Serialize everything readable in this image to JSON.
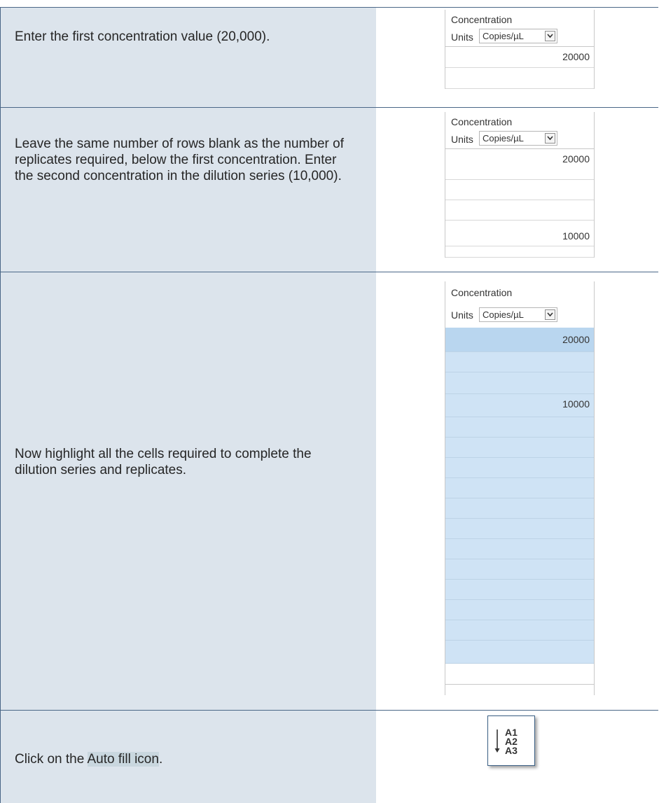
{
  "rows": [
    {
      "instruction": "Enter the first concentration value (20,000)."
    },
    {
      "instruction": "Leave the same number of rows blank as the number of replicates required, below the first concentration. Enter the second concentration in the dilution series (10,000)."
    },
    {
      "instruction": "Now highlight all the cells required to complete the dilution series and replicates."
    },
    {
      "instruction_prefix": "Click on the ",
      "instruction_highlight": "Auto fill icon",
      "instruction_suffix": "."
    }
  ],
  "grid": {
    "title": "Concentration",
    "units_label": "Units",
    "units_value": "Copies/µL",
    "value_first": "20000",
    "value_second": "10000"
  },
  "autofill_icon": {
    "name": "auto-fill-icon",
    "lines": [
      "A1",
      "A2",
      "A3"
    ]
  },
  "colors": {
    "instruction_bg": "#dce4ec",
    "border": "#4a6787",
    "selection": "#cfe3f5",
    "text_highlight": "#c9d7df"
  }
}
